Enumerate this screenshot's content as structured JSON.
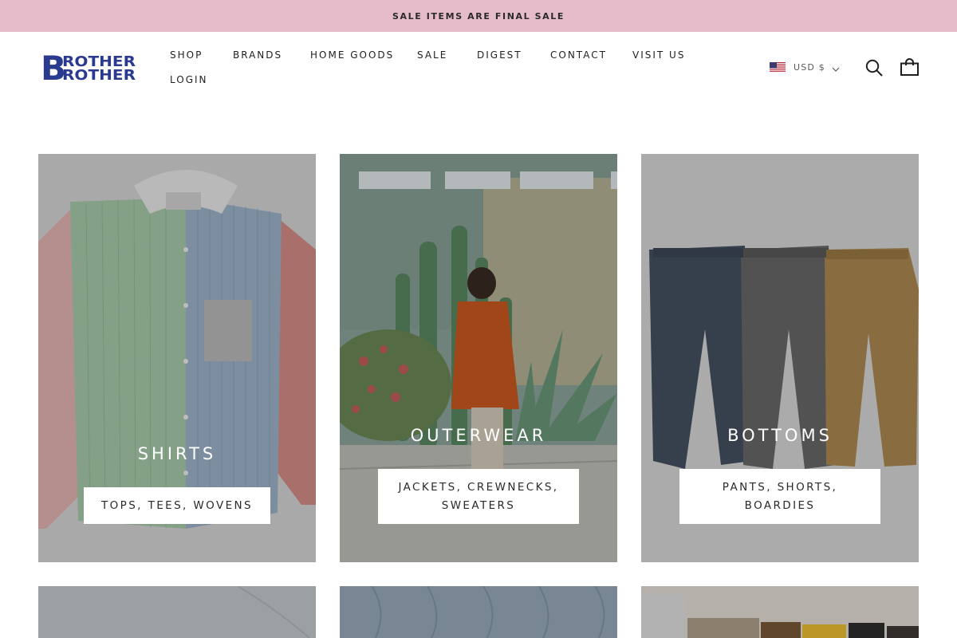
{
  "announcement": {
    "text": "SALE ITEMS ARE FINAL SALE"
  },
  "brand": {
    "line1": "ROTHER",
    "line2": "ROTHER",
    "initial": "B",
    "color": "#2a3a8f"
  },
  "nav": {
    "items": [
      "SHOP",
      "BRANDS",
      "HOME GOODS",
      "SALE",
      "DIGEST",
      "CONTACT",
      "VISIT US",
      "LOGIN"
    ]
  },
  "currency": {
    "label": "USD $",
    "flag_icon": "us-flag-icon",
    "chevron_icon": "chevron-down-icon"
  },
  "header_icons": {
    "search": "search-icon",
    "cart": "shopping-bag-icon"
  },
  "colors": {
    "announcement_bg": "#e6bccb",
    "brand_blue": "#2a3a8f",
    "page_bg": "#ffffff"
  },
  "collections": [
    {
      "title": "SHIRTS",
      "button": "TOPS, TEES, WOVENS"
    },
    {
      "title": "OUTERWEAR",
      "button": "JACKETS, CREWNECKS, SWEATERS"
    },
    {
      "title": "BOTTOMS",
      "button": "PANTS, SHORTS, BOARDIES"
    }
  ]
}
